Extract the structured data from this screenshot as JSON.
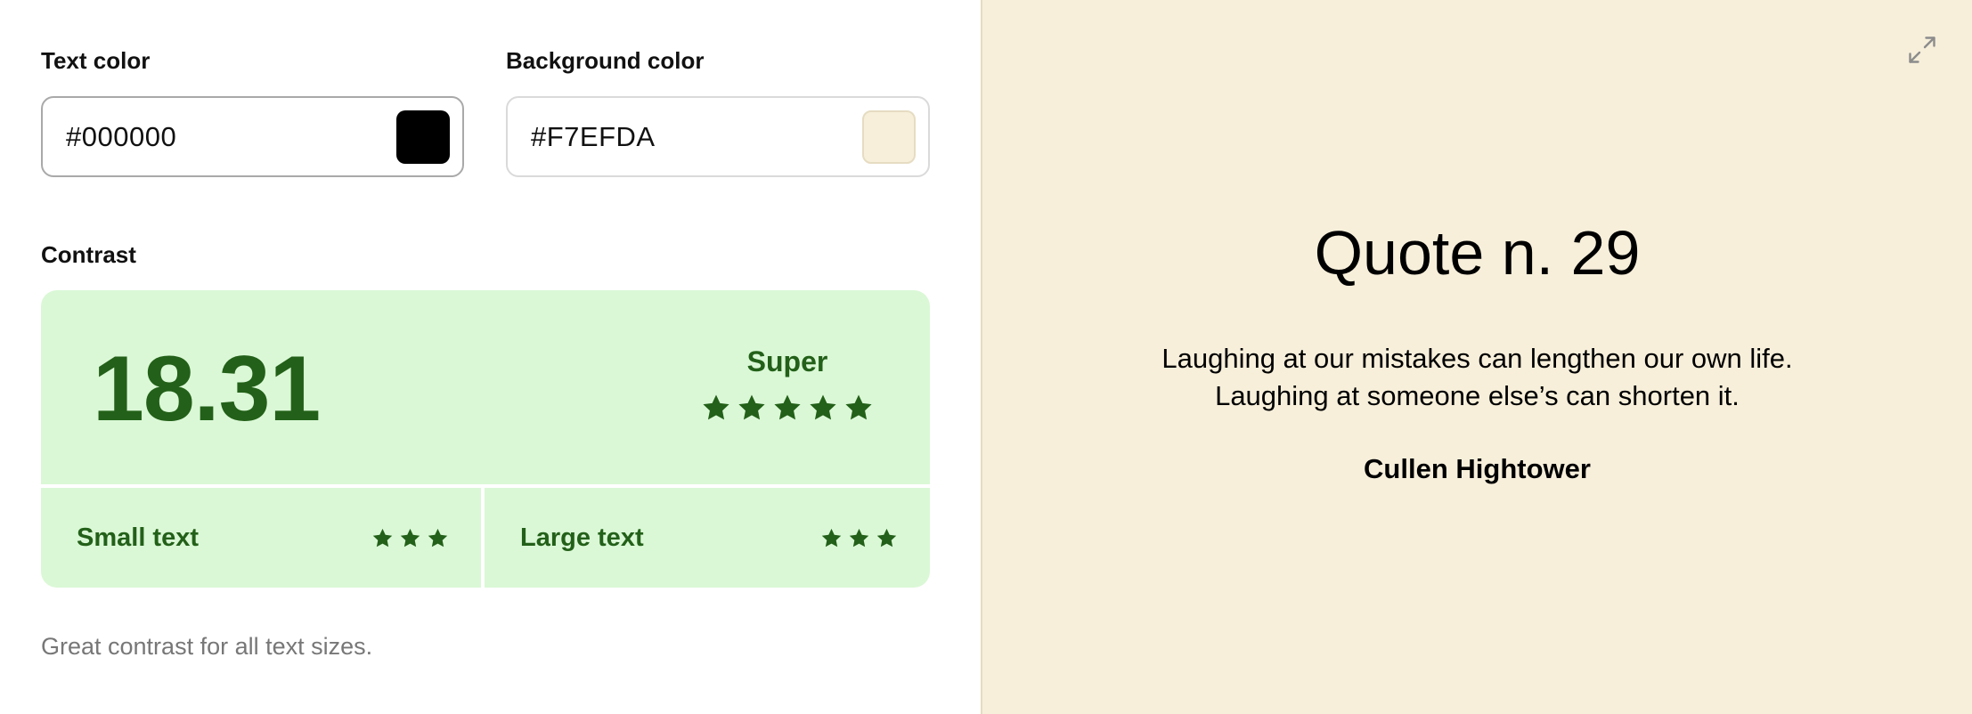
{
  "text_color": {
    "label": "Text color",
    "value": "#000000",
    "swatch": "#000000"
  },
  "background_color": {
    "label": "Background color",
    "value": "#F7EFDA",
    "swatch": "#F7EFDA"
  },
  "contrast": {
    "label": "Contrast",
    "ratio": "18.31",
    "rating": "Super",
    "rating_stars": 5,
    "small_text": {
      "label": "Small text",
      "stars": 3
    },
    "large_text": {
      "label": "Large text",
      "stars": 3
    },
    "card_color": "#DAF8D6",
    "accent_color": "#236019"
  },
  "helper_text": "Great contrast for all text sizes.",
  "preview": {
    "expand_icon": "expand-icon",
    "title": "Quote n. 29",
    "quote_line_1": "Laughing at our mistakes can lengthen our own life.",
    "quote_line_2": "Laughing at someone else’s can shorten it.",
    "author": "Cullen Hightower"
  }
}
